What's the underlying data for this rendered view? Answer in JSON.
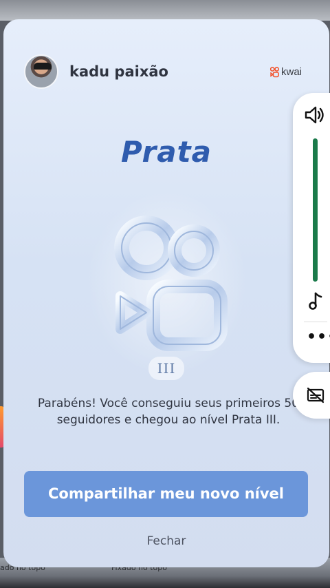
{
  "user": {
    "name": "kadu paixão"
  },
  "brand": {
    "name": "kwai"
  },
  "level": {
    "title": "Prata",
    "tier": "III"
  },
  "message": "Parabéns! Você conseguiu seus primeiros 50 seguidores e chegou ao nível Prata III.",
  "actions": {
    "share_label": "Compartilhar meu novo nível",
    "close_label": "Fechar"
  },
  "side_panel": {
    "volume_level": 1.0,
    "icons": [
      "volume-icon",
      "music-note-icon",
      "more-icon",
      "captions-off-icon"
    ]
  },
  "background": {
    "left_text": "ado no topo",
    "right_text": "Fixado no topo"
  },
  "colors": {
    "accent": "#6b96da",
    "title": "#2f5cae",
    "volume": "#1a7a4a"
  }
}
